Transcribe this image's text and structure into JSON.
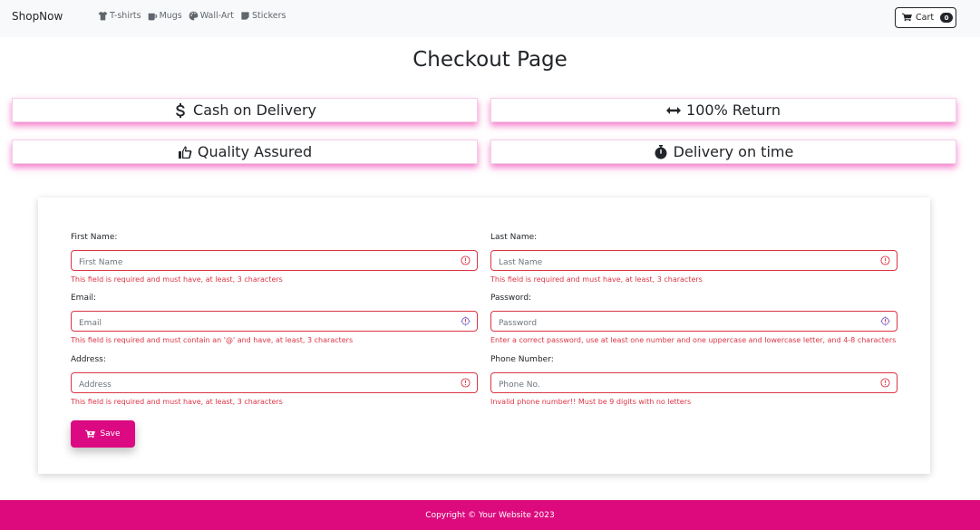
{
  "navbar": {
    "brand": "ShopNow",
    "links": [
      {
        "label": "T-shirts",
        "icon": "tshirt-icon"
      },
      {
        "label": "Mugs",
        "icon": "mug-icon"
      },
      {
        "label": "Wall-Art",
        "icon": "palette-icon"
      },
      {
        "label": "Stickers",
        "icon": "sticker-icon"
      }
    ],
    "cart": {
      "label": "Cart",
      "count": "0",
      "icon": "cart-icon"
    }
  },
  "page_title": "Checkout Page",
  "features": [
    {
      "label": "Cash on Delivery",
      "icon": "dollar-icon"
    },
    {
      "label": "100% Return",
      "icon": "arrows-horizontal-icon"
    },
    {
      "label": "Quality Assured",
      "icon": "thumbs-up-icon"
    },
    {
      "label": "Delivery on time",
      "icon": "stopwatch-icon"
    }
  ],
  "form": {
    "first_name": {
      "label": "First Name:",
      "placeholder": "First Name",
      "value": "",
      "error": "This field is required and must have, at least, 3 characters"
    },
    "last_name": {
      "label": "Last Name:",
      "placeholder": "Last Name",
      "value": "",
      "error": "This field is required and must have, at least, 3 characters"
    },
    "email": {
      "label": "Email:",
      "placeholder": "Email",
      "value": "",
      "error": "This field is required and must contain an '@' and have, at least, 3 characters"
    },
    "password": {
      "label": "Password:",
      "placeholder": "Password",
      "value": "",
      "error": "Enter a correct password, use at least one number and one uppercase and lowercase letter, and 4-8 characters"
    },
    "address": {
      "label": "Address:",
      "placeholder": "Address",
      "value": "",
      "error": "This field is required and must have, at least, 3 characters"
    },
    "phone": {
      "label": "Phone Number:",
      "placeholder": "Phone No.",
      "value": "",
      "error": "Invalid phone number!! Must be 9 digits with no letters"
    },
    "save_label": "Save"
  },
  "footer": {
    "text": "Copyright © Your Website 2023"
  },
  "colors": {
    "accent": "#dc0a82",
    "error": "#dc3545",
    "navbar_bg": "#f8f9fa"
  }
}
